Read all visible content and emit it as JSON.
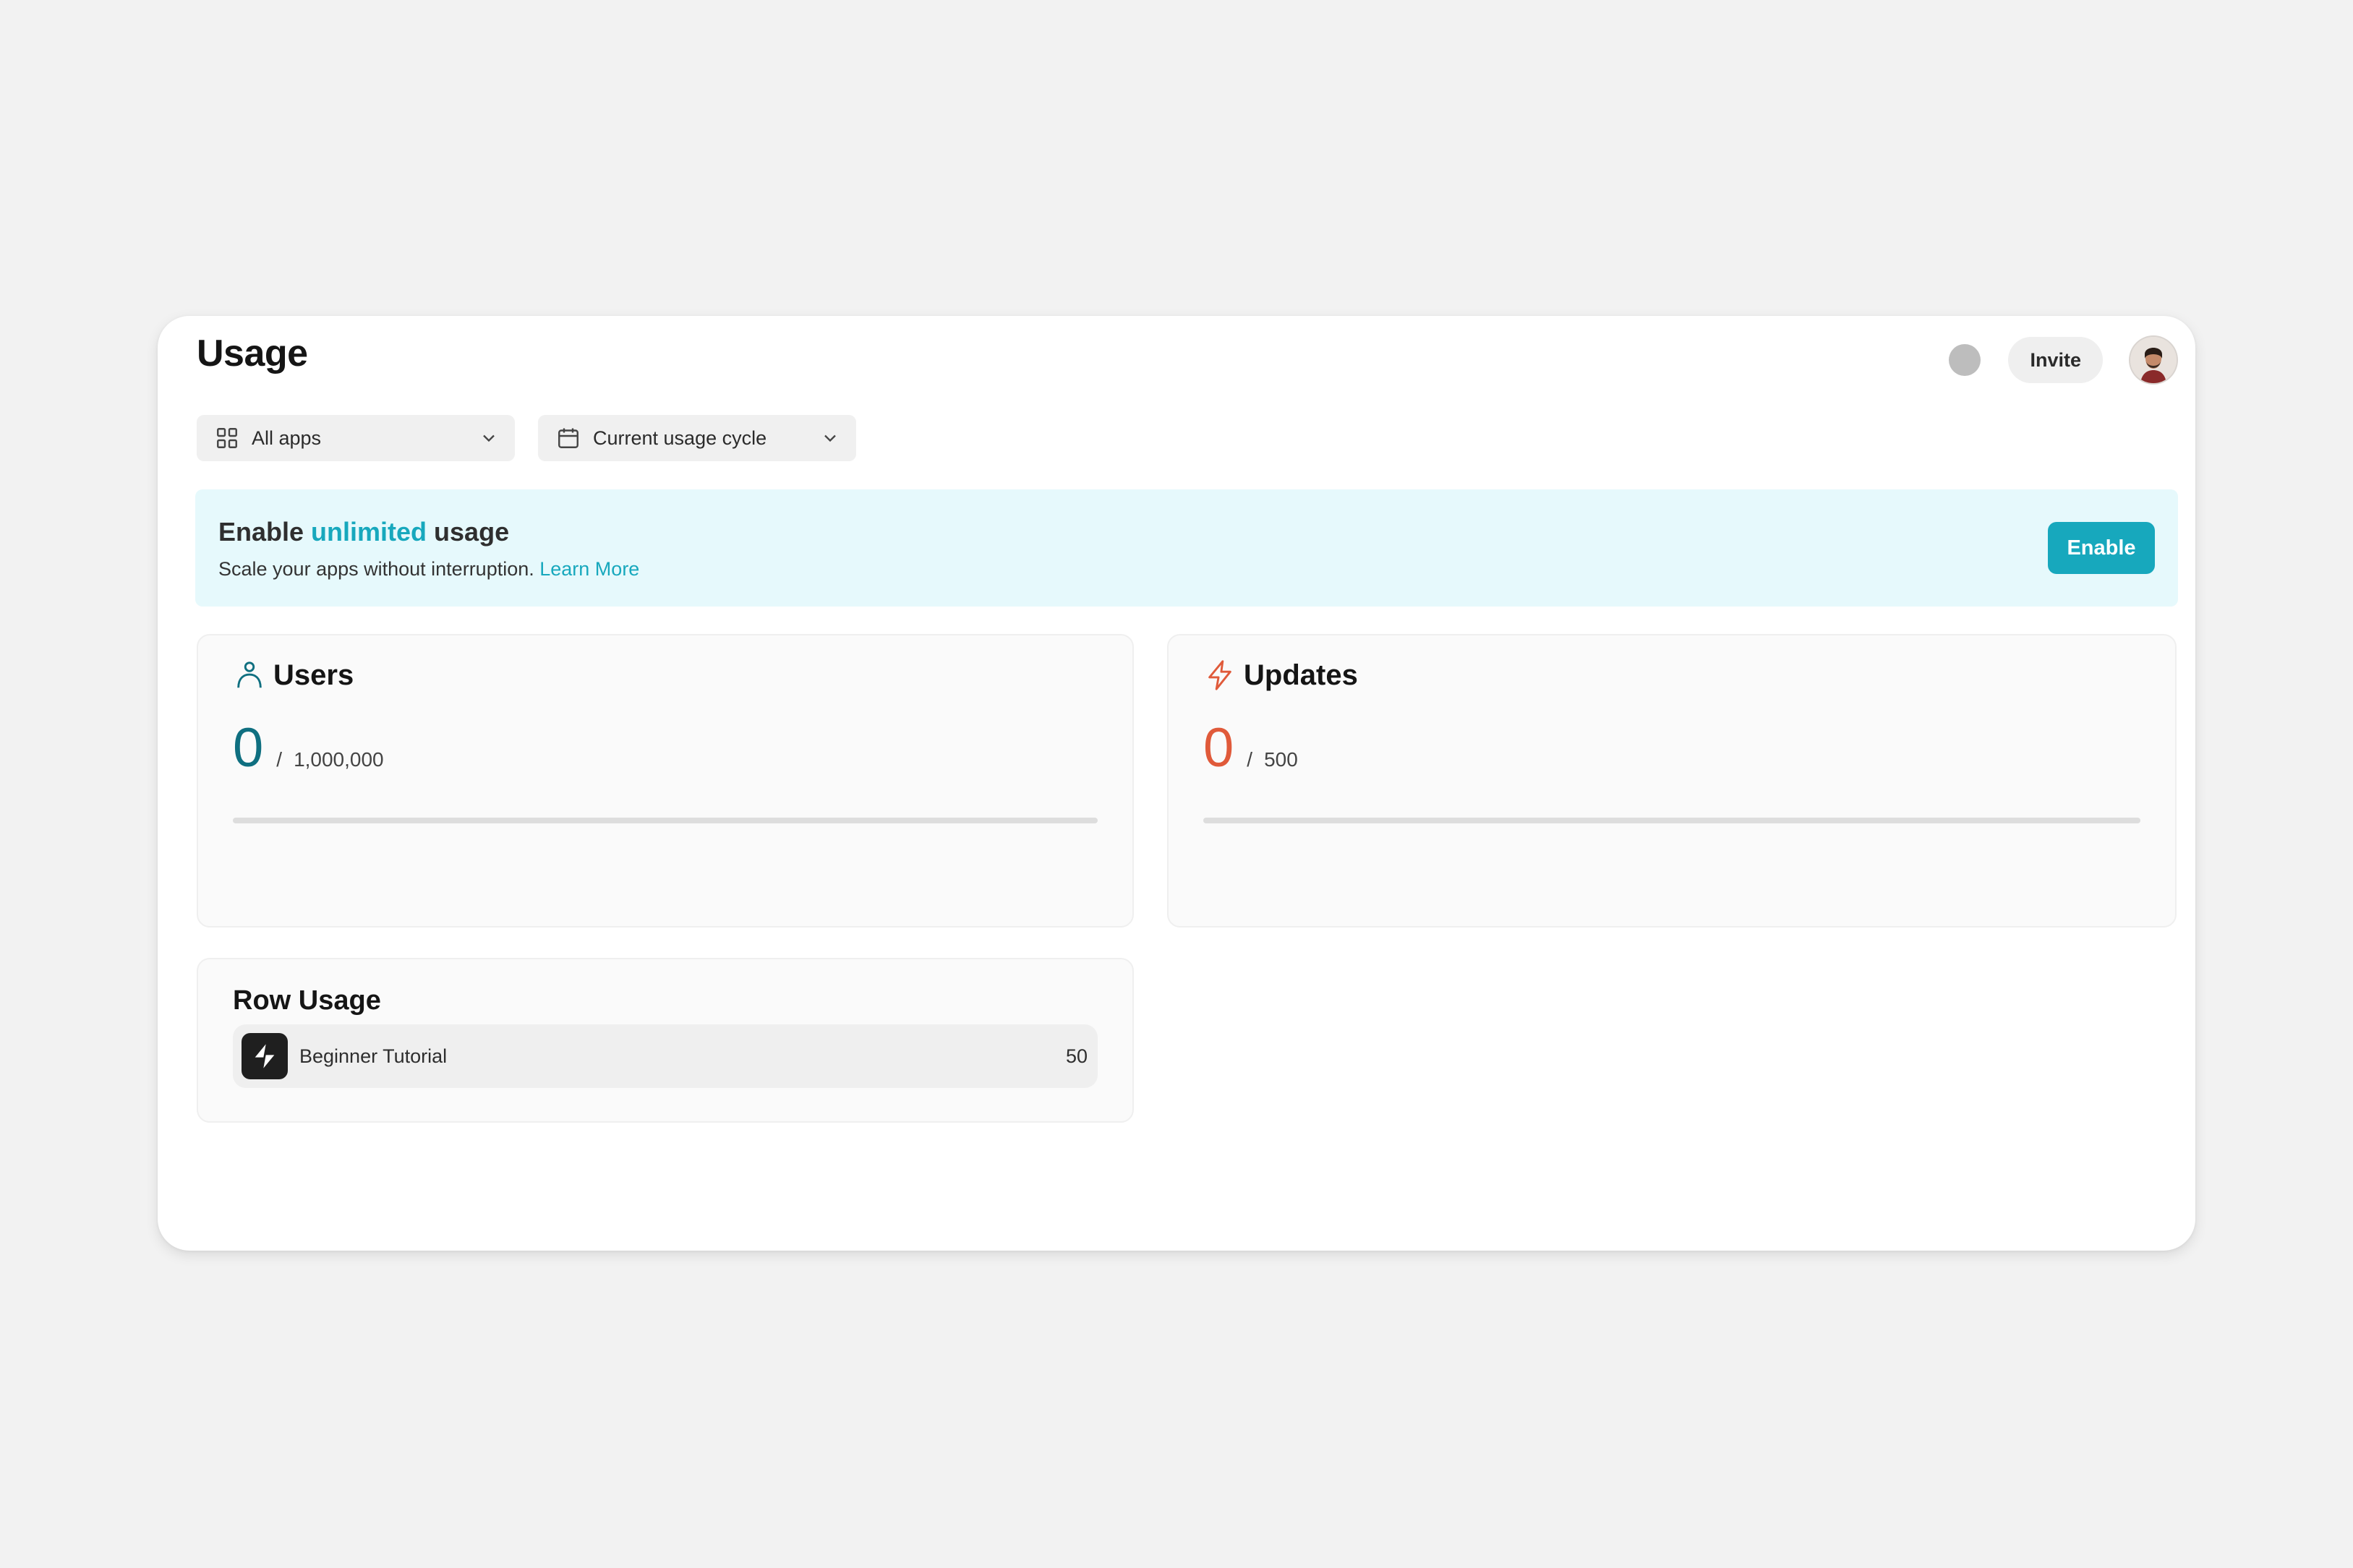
{
  "header": {
    "title": "Usage",
    "invite_label": "Invite",
    "status_dot_color": "#bdbdbd"
  },
  "filters": {
    "apps": {
      "icon": "grid-icon",
      "value": "All apps"
    },
    "cycle": {
      "icon": "calendar-icon",
      "value": "Current usage cycle"
    }
  },
  "banner": {
    "title_prefix": "Enable ",
    "title_accent": "unlimited",
    "title_suffix": " usage",
    "subtitle": "Scale your apps without interruption. ",
    "link": "Learn More",
    "button": "Enable",
    "accent_color": "#17a8bd"
  },
  "users": {
    "icon": "user-icon",
    "title": "Users",
    "value": "0",
    "separator": "/",
    "limit": "1,000,000",
    "progress_fraction": 0,
    "color": "#0f6f80"
  },
  "updates": {
    "icon": "lightning-icon",
    "title": "Updates",
    "value": "0",
    "separator": "/",
    "limit": "500",
    "progress_fraction": 0,
    "color": "#e05a3a"
  },
  "row_usage": {
    "title": "Row Usage",
    "items": [
      {
        "icon": "app-logo-icon",
        "name": "Beginner Tutorial",
        "value": "50"
      }
    ]
  }
}
